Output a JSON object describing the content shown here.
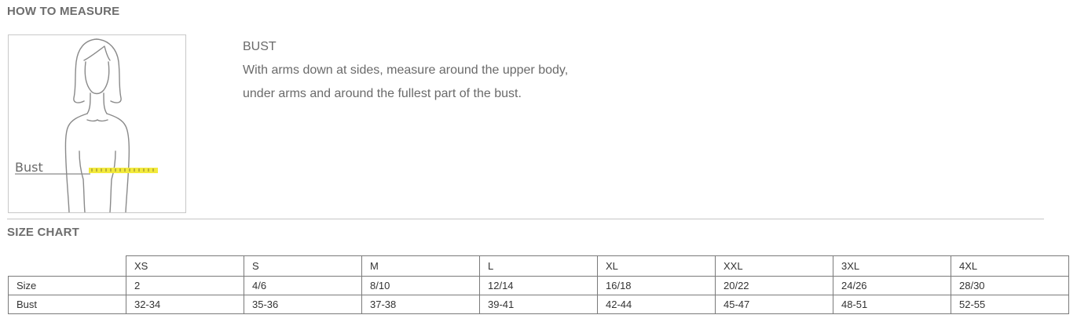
{
  "how_to_measure": {
    "heading": "HOW TO MEASURE",
    "figure_label": "Bust",
    "measure_title": "BUST",
    "measure_line1": "With arms down at sides, measure around the upper body,",
    "measure_line2": "under arms and around the fullest part of the bust."
  },
  "size_chart": {
    "heading": "SIZE CHART",
    "columns": [
      "XS",
      "S",
      "M",
      "L",
      "XL",
      "XXL",
      "3XL",
      "4XL"
    ],
    "rows": [
      {
        "label": "Size",
        "values": [
          "2",
          "4/6",
          "8/10",
          "12/14",
          "16/18",
          "20/22",
          "24/26",
          "28/30"
        ]
      },
      {
        "label": "Bust",
        "values": [
          "32-34",
          "35-36",
          "37-38",
          "39-41",
          "42-44",
          "45-47",
          "48-51",
          "52-55"
        ]
      }
    ]
  },
  "colors": {
    "tape": "#f2ea3c",
    "heading": "#6d6d6d",
    "border": "#7a7a7a"
  }
}
